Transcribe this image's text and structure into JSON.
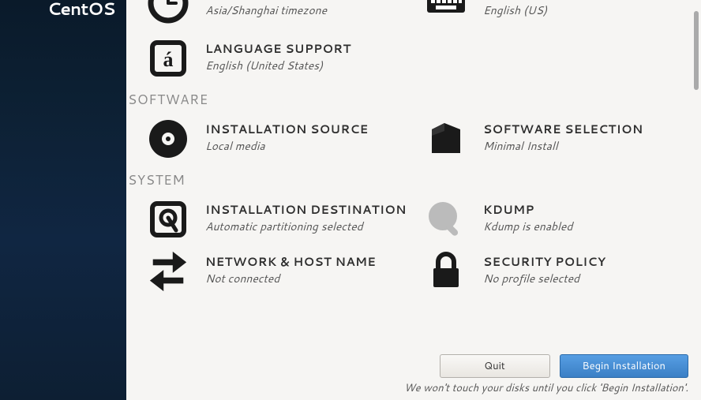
{
  "logo": "CentOS",
  "localization": {
    "time_status": "Asia/Shanghai timezone",
    "keyboard_status": "English (US)",
    "language_title": "LANGUAGE SUPPORT",
    "language_status": "English (United States)"
  },
  "software": {
    "header": "SOFTWARE",
    "source_title": "INSTALLATION SOURCE",
    "source_status": "Local media",
    "selection_title": "SOFTWARE SELECTION",
    "selection_status": "Minimal Install"
  },
  "system": {
    "header": "SYSTEM",
    "destination_title": "INSTALLATION DESTINATION",
    "destination_status": "Automatic partitioning selected",
    "kdump_title": "KDUMP",
    "kdump_status": "Kdump is enabled",
    "network_title": "NETWORK & HOST NAME",
    "network_status": "Not connected",
    "security_title": "SECURITY POLICY",
    "security_status": "No profile selected"
  },
  "footer": {
    "quit": "Quit",
    "begin": "Begin Installation",
    "note": "We won't touch your disks until you click 'Begin Installation'."
  }
}
